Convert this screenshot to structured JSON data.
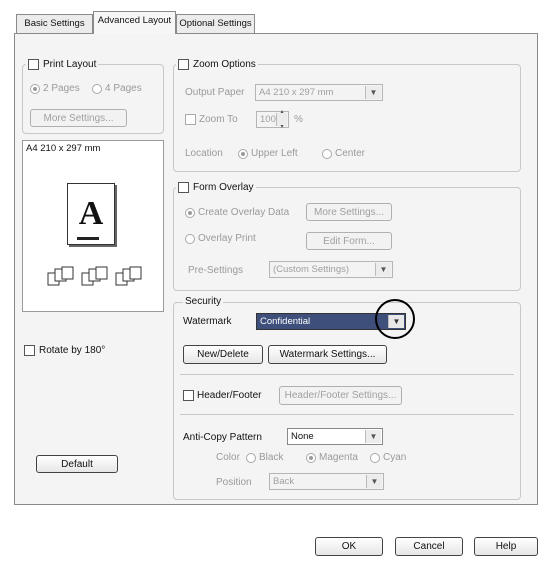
{
  "tabs": [
    {
      "label": "Basic Settings"
    },
    {
      "label": "Advanced Layout"
    },
    {
      "label": "Optional Settings"
    }
  ],
  "print_layout": {
    "title": "Print Layout",
    "radio_2pages": "2 Pages",
    "radio_4pages": "4 Pages",
    "more_settings": "More Settings..."
  },
  "preview": {
    "paper_label": "A4 210 x 297 mm",
    "sample_letter": "A"
  },
  "rotate_label": "Rotate by 180°",
  "default_button": "Default",
  "zoom": {
    "title": "Zoom Options",
    "output_paper_label": "Output Paper",
    "output_paper_value": "A4 210 x 297 mm",
    "zoom_to_label": "Zoom To",
    "zoom_value": "100",
    "zoom_unit": "%",
    "location_label": "Location",
    "upper_left": "Upper Left",
    "center": "Center"
  },
  "form_overlay": {
    "title": "Form Overlay",
    "create_overlay": "Create Overlay Data",
    "more_settings": "More Settings...",
    "overlay_print": "Overlay Print",
    "edit_form": "Edit Form...",
    "presettings_label": "Pre-Settings",
    "presettings_value": "(Custom Settings)"
  },
  "security": {
    "title": "Security",
    "watermark_label": "Watermark",
    "watermark_value": "Confidential",
    "new_delete": "New/Delete",
    "watermark_settings": "Watermark Settings...",
    "header_footer": "Header/Footer",
    "header_footer_settings": "Header/Footer Settings...",
    "anticopy_label": "Anti-Copy Pattern",
    "anticopy_value": "None",
    "color_label": "Color",
    "black": "Black",
    "magenta": "Magenta",
    "cyan": "Cyan",
    "position_label": "Position",
    "position_value": "Back"
  },
  "footer": {
    "ok": "OK",
    "cancel": "Cancel",
    "help": "Help"
  }
}
